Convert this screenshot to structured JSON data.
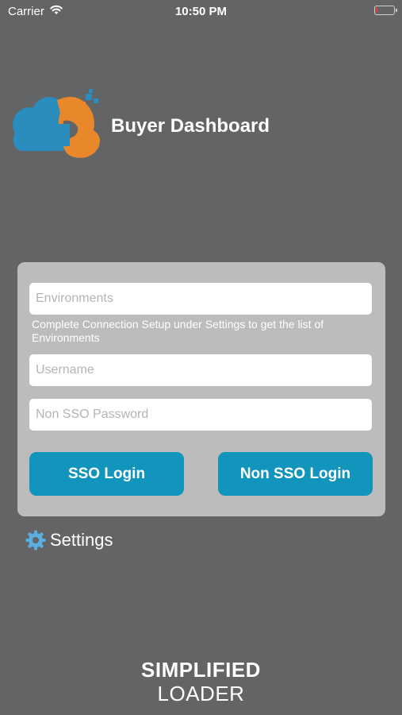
{
  "status_bar": {
    "carrier": "Carrier",
    "time": "10:50 PM",
    "battery_level": 0.1,
    "battery_color": "#e23b2f"
  },
  "header": {
    "title": "Buyer Dashboard",
    "logo_colors": [
      "#2a8dbd",
      "#e8882a"
    ]
  },
  "login_form": {
    "environments_placeholder": "Environments",
    "environments_hint": "Complete Connection Setup under Settings to get the list of Environments",
    "username_placeholder": "Username",
    "password_placeholder": "Non SSO Password",
    "sso_button": "SSO Login",
    "non_sso_button": "Non SSO Login",
    "button_color": "#1295bd"
  },
  "settings": {
    "label": "Settings",
    "icon": "gear-icon"
  },
  "footer": {
    "brand_line1": "SIMPLIFIED",
    "brand_line2": "LOADER"
  }
}
